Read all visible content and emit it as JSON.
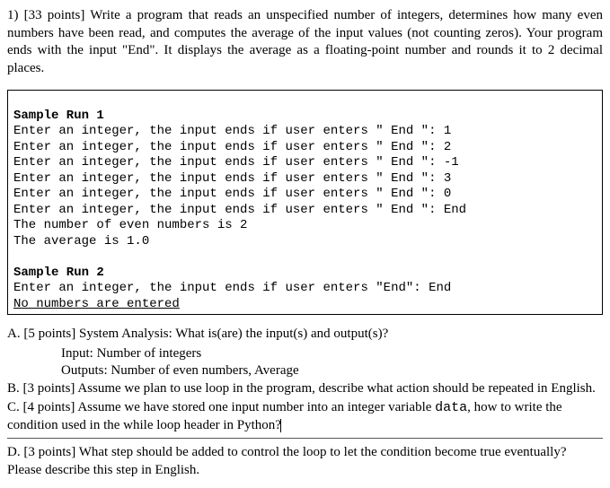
{
  "q": {
    "header": "1) [33 points] Write a program that reads an unspecified number of integers, determines how many even numbers have been read, and computes the average of the input values (not counting zeros). Your program ends with the input \"End\". It displays the average as a floating-point number and rounds it to 2 decimal places."
  },
  "sample1": {
    "title": "Sample Run 1",
    "l1": "Enter an integer, the input ends if user enters \" End \": 1",
    "l2": "Enter an integer, the input ends if user enters \" End \": 2",
    "l3": "Enter an integer, the input ends if user enters \" End \": -1",
    "l4": "Enter an integer, the input ends if user enters \" End \": 3",
    "l5": "Enter an integer, the input ends if user enters \" End \": 0",
    "l6": "Enter an integer, the input ends if user enters \" End \": End",
    "l7": "The number of even numbers is 2",
    "l8": "The average is 1.0"
  },
  "sample2": {
    "title": "Sample Run 2",
    "l1": "Enter an integer, the input ends if user enters \"End\": End",
    "l2": "No numbers are entered"
  },
  "parts": {
    "a": {
      "prompt": "A. [5 points] System Analysis: What is(are) the input(s) and output(s)?",
      "ans1": "Input: Number of integers",
      "ans2": "Outputs: Number of even numbers, Average"
    },
    "b": "B. [3 points] Assume we plan to use loop in the program, describe what action should be repeated in English.",
    "c_pre": "C. [4 points] Assume we have stored one input number into an integer variable ",
    "c_code": "data",
    "c_post": ", how to write the condition used in the while loop header in Python?",
    "d": "D. [3 points] What step should be added to control the loop to let the condition become true eventually? Please describe this step in English."
  }
}
